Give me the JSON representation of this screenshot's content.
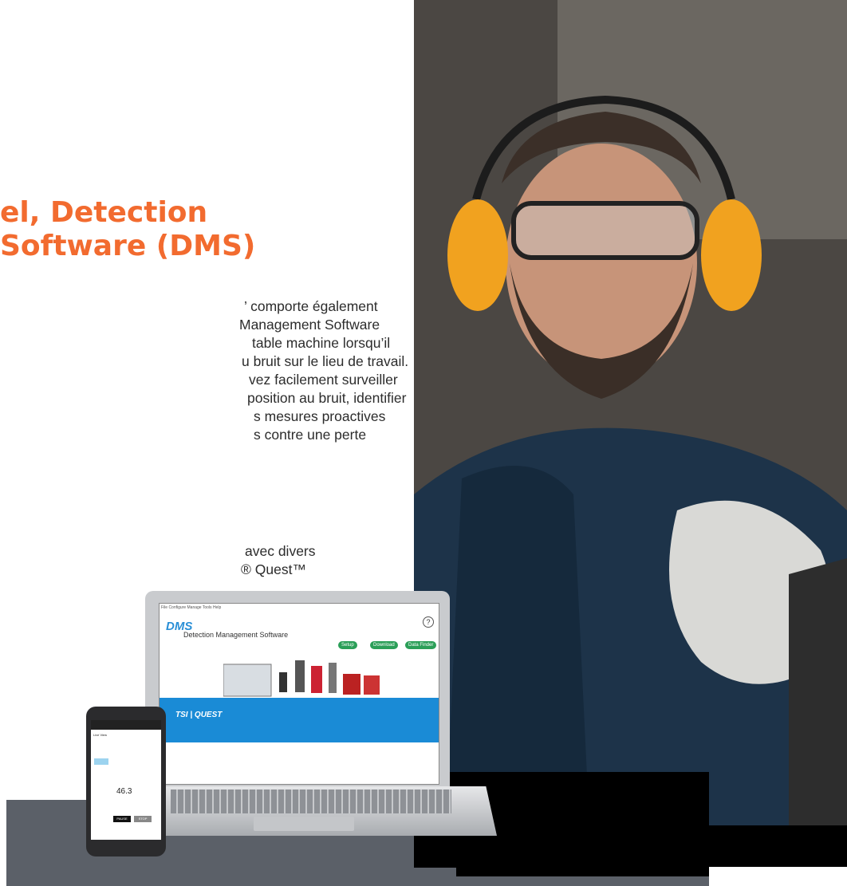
{
  "heading": {
    "line1": "el, Detection",
    "line2": " Software (DMS)"
  },
  "paragraph1": [
    "’ comporte également",
    " Management Software",
    "table machine lorsqu’il",
    "u bruit sur le lieu de travail.",
    "vez facilement surveiller",
    "position au bruit, identifier",
    "s mesures proactives",
    "s contre une perte"
  ],
  "paragraph2": [
    "avec divers",
    "® Quest™",
    ","
  ],
  "laptop_screen": {
    "menu": "File  Configure  Manage  Tools  Help",
    "logo": "DMS",
    "title": "Detection Management Software",
    "help": "?",
    "buttons": [
      "Setup",
      "Download",
      "Data Finder"
    ],
    "brand": "TSI | QUEST"
  },
  "phone_screen": {
    "header": "Live View",
    "value": "46.3",
    "pause": "PAUSE",
    "stop": "STOP"
  },
  "colors": {
    "accent": "#f26b2f",
    "bar": "#5b6068",
    "dms_blue": "#1a8bd6"
  }
}
